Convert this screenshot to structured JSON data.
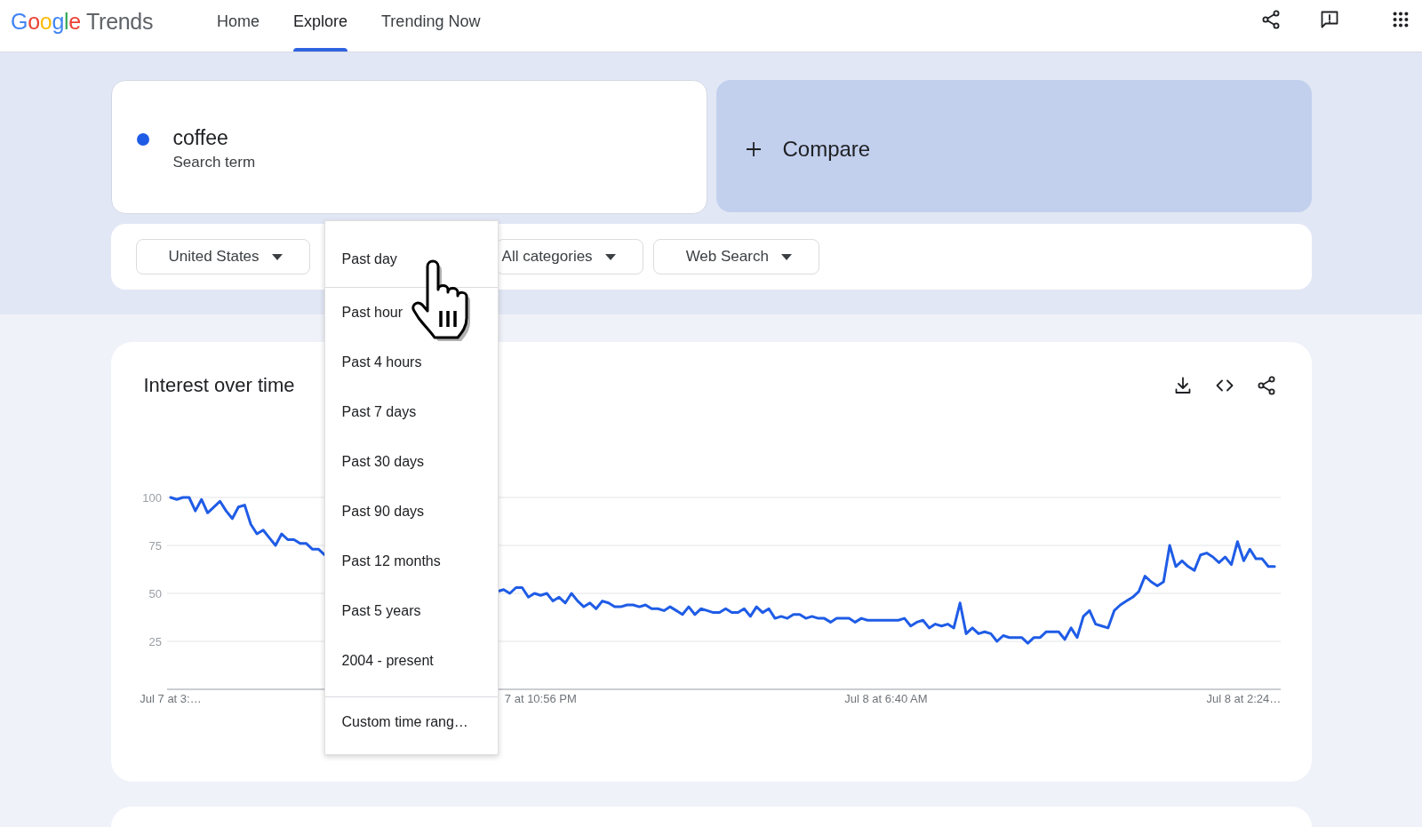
{
  "header": {
    "logo": {
      "brand": "Google",
      "product": "Trends"
    },
    "tabs": [
      {
        "label": "Home",
        "selected": false
      },
      {
        "label": "Explore",
        "selected": true
      },
      {
        "label": "Trending Now",
        "selected": false
      }
    ]
  },
  "search_terms": [
    {
      "term": "coffee",
      "type_label": "Search term",
      "color": "#1f5ce6"
    }
  ],
  "compare": {
    "label": "Compare"
  },
  "filters": [
    {
      "kind": "dropdown",
      "label": "United States"
    },
    {
      "kind": "open_menu",
      "items": [
        {
          "kind": "current",
          "label": "Past day"
        },
        {
          "kind": "option",
          "label": "Past hour"
        },
        {
          "kind": "option",
          "label": "Past 4 hours"
        },
        {
          "kind": "option",
          "label": "Past 7 days"
        },
        {
          "kind": "option",
          "label": "Past 30 days"
        },
        {
          "kind": "option",
          "label": "Past 90 days"
        },
        {
          "kind": "option",
          "label": "Past 12 months"
        },
        {
          "kind": "option",
          "label": "Past 5 years"
        },
        {
          "kind": "option",
          "label": "2004 - present"
        },
        {
          "kind": "custom",
          "label": "Custom time rang…"
        }
      ]
    },
    {
      "kind": "dropdown",
      "label": "All categories"
    },
    {
      "kind": "dropdown",
      "label": "Web Search"
    }
  ],
  "interest_over_time": {
    "title": "Interest over time",
    "chart_data": [
      {
        "type": "line",
        "grid": true,
        "ylim": [
          0,
          100
        ],
        "yticks": [
          25,
          50,
          75,
          100
        ],
        "categories": [
          "Jul 7 at 3:…",
          null,
          null,
          null,
          null,
          null,
          null,
          null,
          null,
          null,
          null,
          null,
          null,
          null,
          null,
          null,
          null,
          null,
          null,
          null,
          null,
          null,
          null,
          null,
          null,
          null,
          null,
          null,
          null,
          null,
          null,
          null,
          null,
          null,
          null,
          null,
          null,
          null,
          null,
          null,
          null,
          null,
          null,
          null,
          null,
          null,
          null,
          null,
          null,
          null,
          null,
          null,
          null,
          null,
          null,
          null,
          null,
          null,
          null,
          null,
          "7 at 10:56 PM",
          null,
          null,
          null,
          null,
          null,
          null,
          null,
          null,
          null,
          null,
          null,
          null,
          null,
          null,
          null,
          null,
          null,
          null,
          null,
          null,
          null,
          null,
          null,
          null,
          null,
          null,
          null,
          null,
          null,
          null,
          null,
          null,
          null,
          null,
          null,
          null,
          null,
          null,
          null,
          null,
          null,
          null,
          null,
          null,
          null,
          null,
          null,
          null,
          null,
          null,
          null,
          null,
          null,
          null,
          null,
          "Jul 8 at 6:40 AM",
          null,
          null,
          null,
          null,
          null,
          null,
          null,
          null,
          null,
          null,
          null,
          null,
          null,
          null,
          null,
          null,
          null,
          null,
          null,
          null,
          null,
          null,
          null,
          null,
          null,
          null,
          null,
          null,
          null,
          null,
          null,
          null,
          null,
          null,
          null,
          null,
          null,
          null,
          null,
          null,
          null,
          null,
          null,
          null,
          null,
          null,
          null,
          null,
          null,
          null,
          null,
          null,
          null,
          null,
          null,
          null,
          null,
          "Jul 8 at 2:24…",
          null,
          null,
          null,
          null,
          null
        ],
        "series": [
          {
            "color": "#1f5ce6",
            "values": [
              100,
              99,
              100,
              100,
              93,
              99,
              92,
              95,
              98,
              93,
              89,
              95,
              96,
              86,
              81,
              83,
              79,
              75,
              81,
              78,
              78,
              76,
              76,
              73,
              73,
              70,
              null,
              null,
              null,
              null,
              null,
              null,
              null,
              null,
              null,
              null,
              null,
              null,
              null,
              null,
              null,
              null,
              null,
              null,
              null,
              null,
              null,
              null,
              null,
              null,
              null,
              null,
              null,
              51,
              52,
              50,
              53,
              53,
              48,
              50,
              49,
              50,
              46,
              48,
              45,
              50,
              46,
              43,
              45,
              42,
              46,
              45,
              43,
              43,
              44,
              44,
              43,
              44,
              42,
              42,
              41,
              43,
              41,
              39,
              43,
              39,
              42,
              41,
              40,
              40,
              42,
              40,
              40,
              42,
              38,
              43,
              40,
              42,
              37,
              38,
              37,
              39,
              39,
              37,
              38,
              37,
              37,
              35,
              37,
              37,
              37,
              35,
              37,
              36,
              36,
              36,
              36,
              36,
              36,
              37,
              33,
              35,
              36,
              32,
              34,
              33,
              34,
              32,
              45,
              29,
              32,
              29,
              30,
              29,
              25,
              28,
              27,
              27,
              27,
              24,
              27,
              27,
              30,
              30,
              30,
              26,
              32,
              27,
              38,
              41,
              34,
              33,
              32,
              41,
              44,
              46,
              48,
              51,
              59,
              56,
              54,
              56,
              75,
              64,
              67,
              64,
              62,
              70,
              71,
              69,
              66,
              69,
              65,
              77,
              67,
              73,
              68,
              68,
              64,
              64
            ]
          }
        ]
      }
    ]
  }
}
